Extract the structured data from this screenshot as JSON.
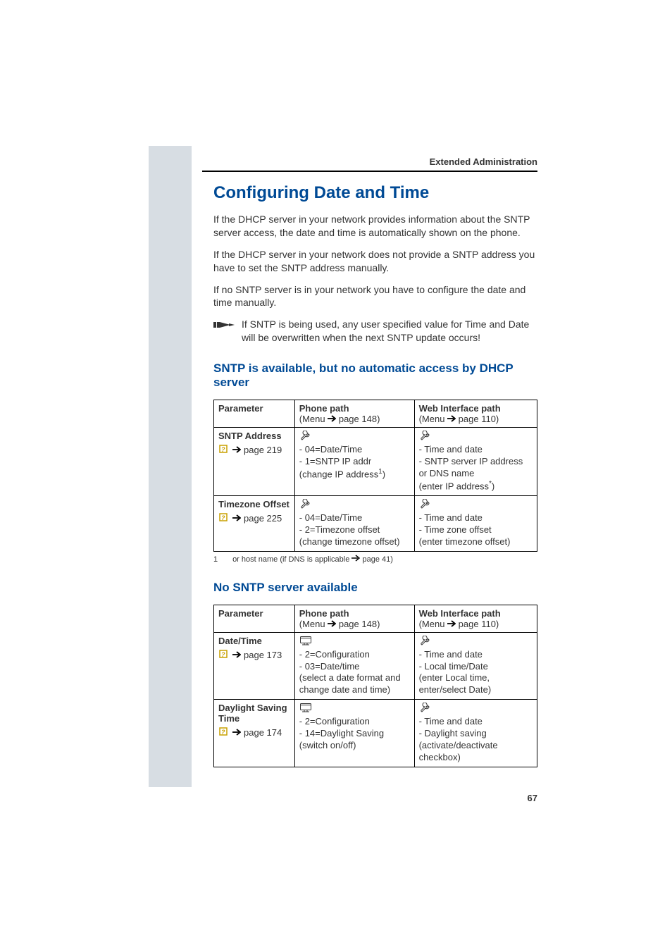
{
  "header": {
    "section": "Extended Administration"
  },
  "page_number": "67",
  "title": "Configuring Date and Time",
  "intro_paragraphs": [
    "If the DHCP server in your network provides information about the SNTP server access, the date and time is automatically shown on the phone.",
    "If the DHCP server in your network does not provide a SNTP address you have to set the SNTP address manually.",
    "If no SNTP server is in your network you have to configure the date and time manually."
  ],
  "note": "If SNTP is being used, any user specified value for Time and Date will be overwritten when the next SNTP update occurs!",
  "subsection1": {
    "title": "SNTP is available, but no automatic access by DHCP server",
    "table": {
      "headers": {
        "parameter": "Parameter",
        "phone_path": "Phone path",
        "phone_path_sub_prefix": "(Menu ",
        "phone_path_sub_page": "page 148)",
        "web_path": "Web Interface path",
        "web_path_sub_prefix": "(Menu ",
        "web_path_sub_page": "page 110)"
      },
      "rows": [
        {
          "name": "SNTP Address",
          "page_ref": "page 219",
          "phone_lines": [
            "- 04=Date/Time",
            "- 1=SNTP IP addr",
            "(change IP address¹)"
          ],
          "web_lines": [
            "- Time and date",
            "- SNTP server IP address or DNS name",
            "(enter IP address*)"
          ]
        },
        {
          "name": "Timezone Offset",
          "page_ref": "page 225",
          "phone_lines": [
            "- 04=Date/Time",
            "- 2=Timezone offset",
            "(change timezone offset)"
          ],
          "web_lines": [
            "- Time and date",
            "- Time zone offset",
            "(enter timezone offset)"
          ]
        }
      ]
    },
    "footnote_num": "1",
    "footnote_text_prefix": "or host name (if DNS is applicable ",
    "footnote_text_page": "page 41)"
  },
  "subsection2": {
    "title": "No SNTP server available",
    "table": {
      "headers": {
        "parameter": "Parameter",
        "phone_path": "Phone path",
        "phone_path_sub_prefix": "(Menu ",
        "phone_path_sub_page": "page 148)",
        "web_path": "Web Interface path",
        "web_path_sub_prefix": "(Menu ",
        "web_path_sub_page": "page 110)"
      },
      "rows": [
        {
          "name": "Date/Time",
          "page_ref": "page 173",
          "phone_lines": [
            "- 2=Configuration",
            "- 03=Date/time",
            "(select a date format and change date and time)"
          ],
          "web_lines": [
            "- Time and date",
            "- Local time/Date",
            "(enter Local time, enter/select Date)"
          ]
        },
        {
          "name": "Daylight Saving Time",
          "page_ref": "page 174",
          "phone_lines": [
            "- 2=Configuration",
            "- 14=Daylight Saving",
            "(switch on/off)"
          ],
          "web_lines": [
            "- Time and date",
            "- Daylight saving",
            "(activate/deactivate checkbox)"
          ]
        }
      ]
    }
  }
}
